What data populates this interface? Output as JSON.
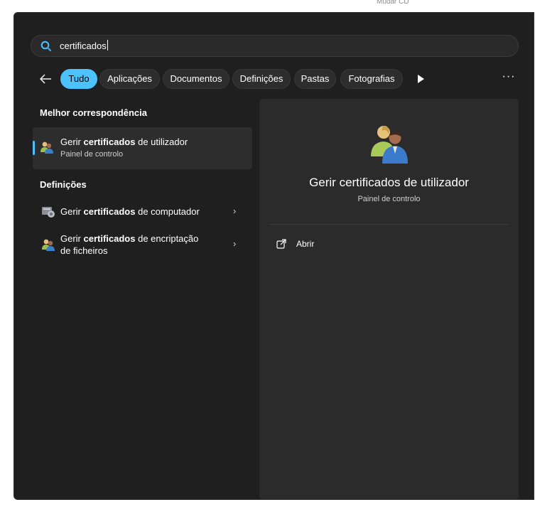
{
  "top_caption": "Mudar CD",
  "search": {
    "query": "certificados"
  },
  "filters": {
    "items": [
      {
        "label": "Tudo"
      },
      {
        "label": "Aplicações"
      },
      {
        "label": "Documentos"
      },
      {
        "label": "Definições"
      },
      {
        "label": "Pastas"
      },
      {
        "label": "Fotografias"
      }
    ]
  },
  "best_match": {
    "heading": "Melhor correspondência",
    "title_pre": "Gerir ",
    "title_bold": "certificados",
    "title_post": " de utilizador",
    "subtitle": "Painel de controlo"
  },
  "settings": {
    "heading": "Definições",
    "items": [
      {
        "pre": "Gerir ",
        "bold": "certificados",
        "post": " de computador",
        "icon": "cert-manager-icon"
      },
      {
        "pre": "Gerir ",
        "bold": "certificados",
        "post": " de encriptação",
        "line2": "de ficheiros",
        "icon": "users-icon"
      }
    ]
  },
  "preview": {
    "title": "Gerir certificados de utilizador",
    "subtitle": "Painel de controlo",
    "open_label": "Abrir"
  },
  "colors": {
    "accent": "#4cc2ff",
    "background": "#1f1f1f",
    "panel": "#2b2b2b"
  }
}
